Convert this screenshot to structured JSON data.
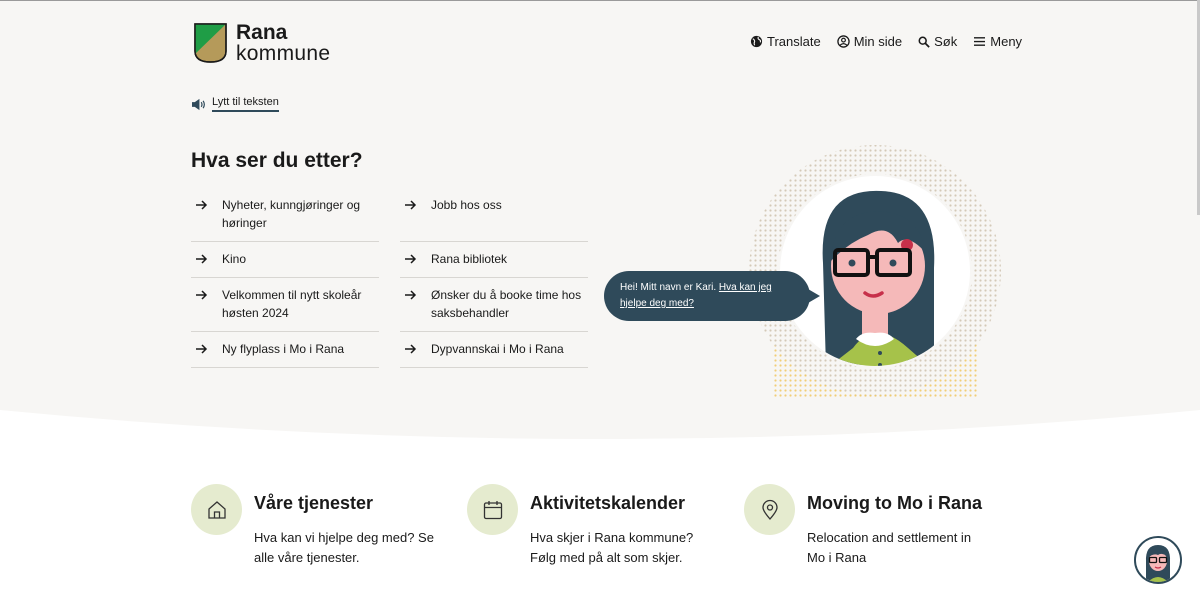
{
  "logo": {
    "line1": "Rana",
    "line2": "kommune"
  },
  "nav": {
    "translate": "Translate",
    "min_side": "Min side",
    "sok": "Søk",
    "meny": "Meny"
  },
  "listen": {
    "label": "Lytt til teksten"
  },
  "hero": {
    "heading": "Hva ser du etter?",
    "links": [
      "Nyheter, kunngjøringer og høringer",
      "Jobb hos oss",
      "Kino",
      "Rana bibliotek",
      "Velkommen til nytt skoleår høsten 2024",
      "Ønsker du å booke time hos saksbehandler",
      "Ny flyplass i Mo i Rana",
      "Dypvannskai i Mo i Rana"
    ]
  },
  "chat": {
    "intro": "Hei! Mitt navn er Kari. ",
    "link": "Hva kan jeg hjelpe deg med?"
  },
  "cards": [
    {
      "title": "Våre tjenester",
      "desc": "Hva kan vi hjelpe deg med? Se alle våre tjenester.",
      "icon": "house-icon"
    },
    {
      "title": "Aktivitetskalender",
      "desc": "Hva skjer i Rana kommune? Følg med på alt som skjer.",
      "icon": "calendar-icon"
    },
    {
      "title": "Moving to Mo i Rana",
      "desc": "Relocation and settlement in Mo i Rana",
      "icon": "location-pin-icon"
    }
  ],
  "colors": {
    "dark_blue": "#2f4a5a",
    "logo_green": "#1f9d46",
    "logo_gold": "#b59a5a",
    "card_circle": "#e5ebcf",
    "background": "#f7f6f4"
  }
}
